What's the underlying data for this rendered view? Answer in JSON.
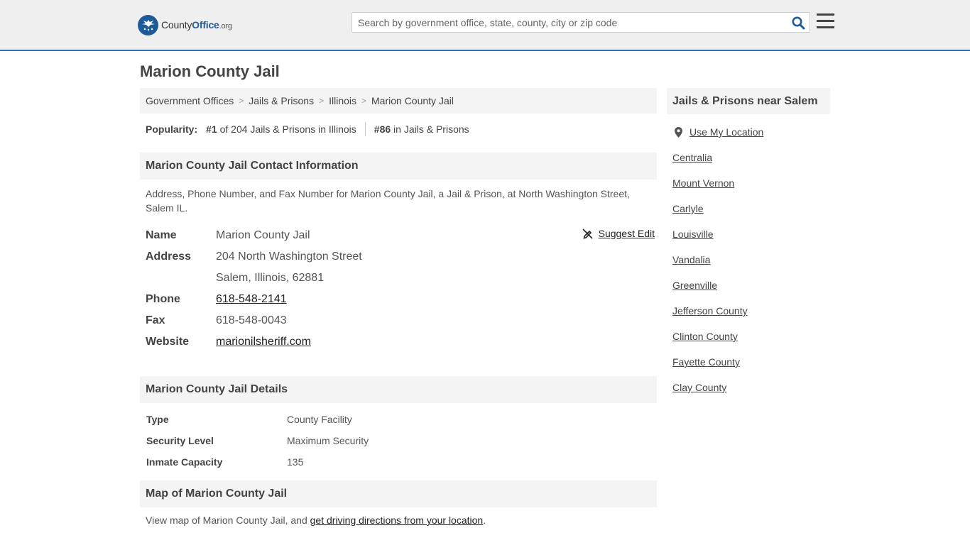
{
  "header": {
    "logo_text_a": "County",
    "logo_text_b": "Office",
    "logo_text_c": ".org",
    "search_placeholder": "Search by government office, state, county, city or zip code"
  },
  "page": {
    "title": "Marion County Jail"
  },
  "breadcrumb": [
    {
      "label": "Government Offices"
    },
    {
      "label": "Jails & Prisons"
    },
    {
      "label": "Illinois"
    },
    {
      "label": "Marion County Jail"
    }
  ],
  "popularity": {
    "label": "Popularity:",
    "rank_state": "#1",
    "rank_state_text": "of 204 Jails & Prisons in Illinois",
    "rank_national": "#86",
    "rank_national_text": "in Jails & Prisons"
  },
  "contact": {
    "heading": "Marion County Jail Contact Information",
    "description": "Address, Phone Number, and Fax Number for Marion County Jail, a Jail & Prison, at North Washington Street, Salem IL.",
    "suggest_edit": "Suggest Edit",
    "rows": {
      "name_label": "Name",
      "name_value": "Marion County Jail",
      "address_label": "Address",
      "address_line1": "204 North Washington Street",
      "address_line2": "Salem, Illinois, 62881",
      "phone_label": "Phone",
      "phone_value": "618-548-2141",
      "fax_label": "Fax",
      "fax_value": "618-548-0043",
      "website_label": "Website",
      "website_value": "marionilsheriff.com"
    }
  },
  "details": {
    "heading": "Marion County Jail Details",
    "type_label": "Type",
    "type_value": "County Facility",
    "security_label": "Security Level",
    "security_value": "Maximum Security",
    "capacity_label": "Inmate Capacity",
    "capacity_value": "135"
  },
  "map": {
    "heading": "Map of Marion County Jail",
    "text_before": "View map of Marion County Jail, and ",
    "link_text": "get driving directions from your location",
    "text_after": "."
  },
  "sidebar": {
    "heading": "Jails & Prisons near Salem",
    "use_location": "Use My Location",
    "items": [
      {
        "label": "Centralia"
      },
      {
        "label": "Mount Vernon"
      },
      {
        "label": "Carlyle"
      },
      {
        "label": "Louisville"
      },
      {
        "label": "Vandalia"
      },
      {
        "label": "Greenville"
      },
      {
        "label": "Jefferson County"
      },
      {
        "label": "Clinton County"
      },
      {
        "label": "Fayette County"
      },
      {
        "label": "Clay County"
      }
    ]
  },
  "colors": {
    "brand_blue": "#1f5b98",
    "header_border": "#2a73b5",
    "section_bg": "#f4f4f4"
  }
}
